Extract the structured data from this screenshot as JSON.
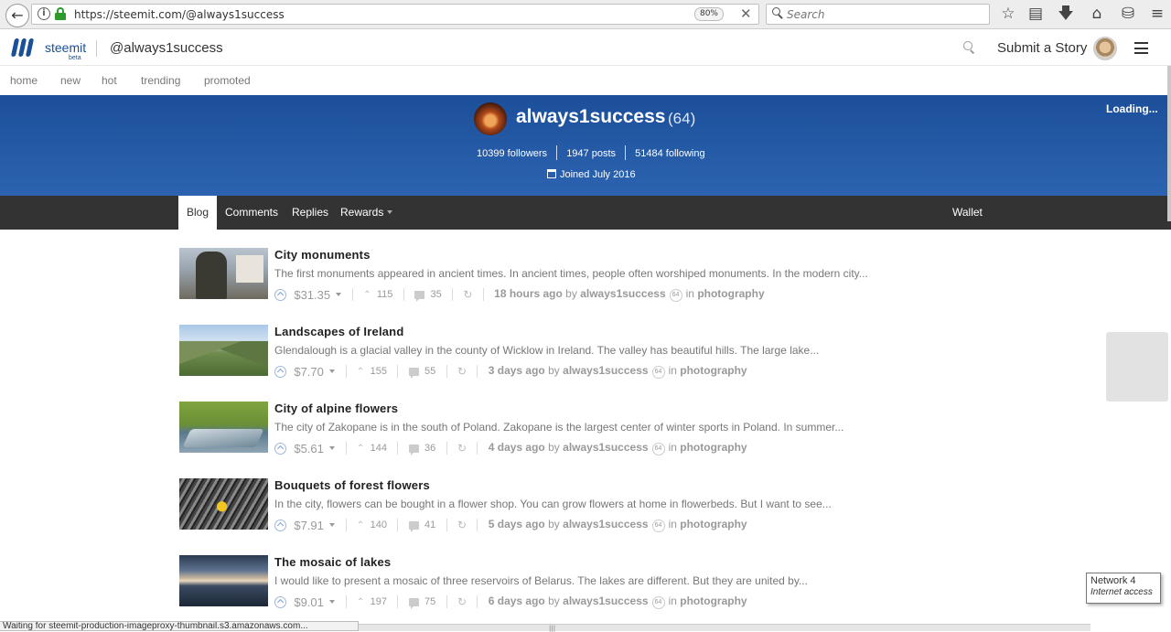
{
  "browser": {
    "url": "https://steemit.com/@always1success",
    "zoom": "80%",
    "search_placeholder": "Search",
    "status": "Waiting for steemit-production-imageproxy-thumbnail.s3.amazonaws.com..."
  },
  "header": {
    "logo_text": "steemit",
    "logo_beta": "beta",
    "user_path": "@always1success",
    "submit_label": "Submit a Story"
  },
  "subnav": {
    "items": [
      "home",
      "new",
      "hot",
      "trending",
      "promoted"
    ]
  },
  "profile": {
    "name": "always1success",
    "reputation": "(64)",
    "followers": "10399 followers",
    "posts": "1947 posts",
    "following": "51484 following",
    "joined": "Joined July 2016",
    "loading": "Loading..."
  },
  "tabs": {
    "blog": "Blog",
    "comments": "Comments",
    "replies": "Replies",
    "rewards": "Rewards",
    "wallet": "Wallet"
  },
  "posts": [
    {
      "title": "City monuments",
      "excerpt": "The first monuments appeared in ancient times. In ancient times, people often worshiped monuments. In the modern city...",
      "payout": "$31.35",
      "votes": "115",
      "comments": "35",
      "time": "18 hours ago",
      "by": "by",
      "author": "always1success",
      "rep": "64",
      "in": "in",
      "category": "photography"
    },
    {
      "title": "Landscapes of Ireland",
      "excerpt": "Glendalough is a glacial valley in the county of Wicklow in Ireland. The valley has beautiful hills. The large lake...",
      "payout": "$7.70",
      "votes": "155",
      "comments": "55",
      "time": "3 days ago",
      "by": "by",
      "author": "always1success",
      "rep": "64",
      "in": "in",
      "category": "photography"
    },
    {
      "title": "City of alpine flowers",
      "excerpt": "The city of Zakopane is in the south of Poland. Zakopane is the largest center of winter sports in Poland. In summer...",
      "payout": "$5.61",
      "votes": "144",
      "comments": "36",
      "time": "4 days ago",
      "by": "by",
      "author": "always1success",
      "rep": "64",
      "in": "in",
      "category": "photography"
    },
    {
      "title": "Bouquets of forest flowers",
      "excerpt": "In the city, flowers can be bought in a flower shop. You can grow flowers at home in flowerbeds. But I want to see...",
      "payout": "$7.91",
      "votes": "140",
      "comments": "41",
      "time": "5 days ago",
      "by": "by",
      "author": "always1success",
      "rep": "64",
      "in": "in",
      "category": "photography"
    },
    {
      "title": "The mosaic of lakes",
      "excerpt": "I would like to present a mosaic of three reservoirs of Belarus. The lakes are different. But they are united by...",
      "payout": "$9.01",
      "votes": "197",
      "comments": "75",
      "time": "6 days ago",
      "by": "by",
      "author": "always1success",
      "rep": "64",
      "in": "in",
      "category": "photography"
    }
  ],
  "network_tip": {
    "line1": "Network 4",
    "line2": "Internet access"
  },
  "colors": {
    "brand": "#1a5099",
    "banner": "#2c63b0",
    "tabs_bg": "#333333"
  }
}
